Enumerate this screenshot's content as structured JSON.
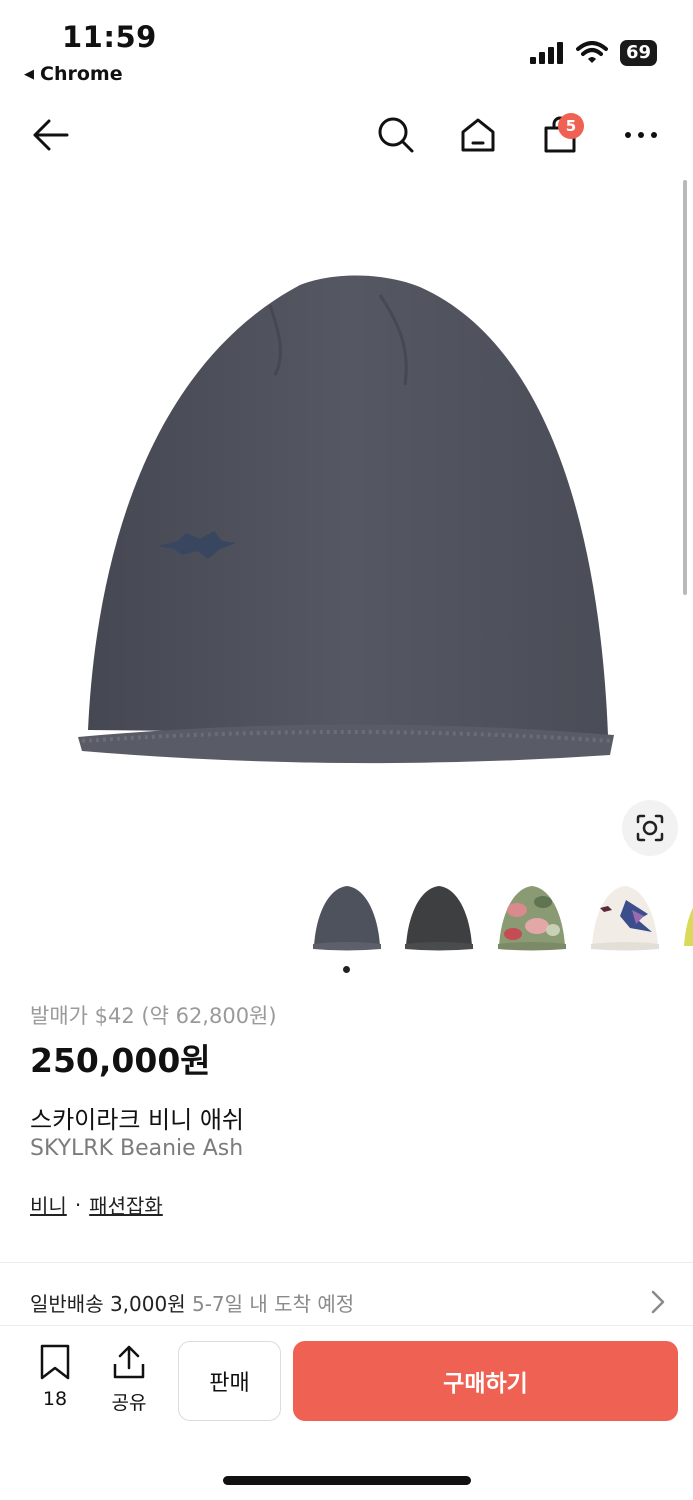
{
  "status_bar": {
    "time": "11:59",
    "back_app": "Chrome",
    "battery": "69"
  },
  "nav": {
    "cart_count": "5"
  },
  "product": {
    "release_price": "발매가 $42 (약 62,800원)",
    "price": "250,000원",
    "name_ko": "스카이라크 비니 애쉬",
    "name_en": "SKYLRK Beanie Ash",
    "categories": [
      "비니",
      "패션잡화"
    ],
    "category_separator": "·"
  },
  "shipping": {
    "label": "일반배송 3,000원",
    "eta": "5-7일 내 도착 예정"
  },
  "bottom_bar": {
    "bookmark_count": "18",
    "share_label": "공유",
    "sell_label": "판매",
    "buy_label": "구매하기"
  },
  "colors": {
    "accent": "#ef6253",
    "beanie_ash": "#50535d",
    "muted_text": "#9a9a9a"
  },
  "thumbnails": [
    {
      "name": "ash",
      "color": "#4e525c"
    },
    {
      "name": "black",
      "color": "#3e3f41"
    },
    {
      "name": "camo",
      "color": "#8a9a72"
    },
    {
      "name": "white-print",
      "color": "#f1ede6"
    },
    {
      "name": "yellow",
      "color": "#d9d95a"
    }
  ]
}
